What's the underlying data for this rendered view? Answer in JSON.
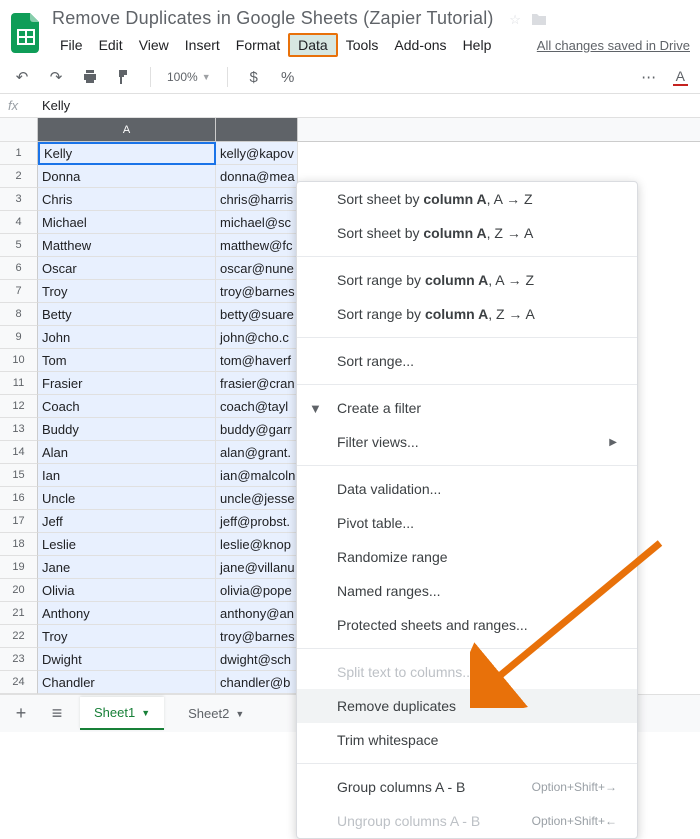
{
  "doc": {
    "title": "Remove Duplicates in Google Sheets (Zapier Tutorial)",
    "saved": "All changes saved in Drive"
  },
  "menubar": [
    "File",
    "Edit",
    "View",
    "Insert",
    "Format",
    "Data",
    "Tools",
    "Add-ons",
    "Help"
  ],
  "menubar_highlight_index": 5,
  "toolbar": {
    "zoom": "100%",
    "currency": "$",
    "percent": "%"
  },
  "formula": {
    "fx": "fx",
    "value": "Kelly"
  },
  "columns": {
    "a": "A",
    "b": ""
  },
  "rows": [
    {
      "n": "1",
      "a": "Kelly",
      "b": "kelly@kapov"
    },
    {
      "n": "2",
      "a": "Donna",
      "b": "donna@mea"
    },
    {
      "n": "3",
      "a": "Chris",
      "b": "chris@harris"
    },
    {
      "n": "4",
      "a": "Michael",
      "b": "michael@sc"
    },
    {
      "n": "5",
      "a": "Matthew",
      "b": "matthew@fc"
    },
    {
      "n": "6",
      "a": "Oscar",
      "b": "oscar@nune"
    },
    {
      "n": "7",
      "a": "Troy",
      "b": "troy@barnes"
    },
    {
      "n": "8",
      "a": "Betty",
      "b": "betty@suare"
    },
    {
      "n": "9",
      "a": "John",
      "b": "john@cho.c"
    },
    {
      "n": "10",
      "a": "Tom",
      "b": "tom@haverf"
    },
    {
      "n": "11",
      "a": "Frasier",
      "b": "frasier@cran"
    },
    {
      "n": "12",
      "a": "Coach",
      "b": "coach@tayl"
    },
    {
      "n": "13",
      "a": "Buddy",
      "b": "buddy@garr"
    },
    {
      "n": "14",
      "a": "Alan",
      "b": "alan@grant."
    },
    {
      "n": "15",
      "a": "Ian",
      "b": "ian@malcoln"
    },
    {
      "n": "16",
      "a": "Uncle",
      "b": "uncle@jesse"
    },
    {
      "n": "17",
      "a": "Jeff",
      "b": "jeff@probst."
    },
    {
      "n": "18",
      "a": "Leslie",
      "b": "leslie@knop"
    },
    {
      "n": "19",
      "a": "Jane",
      "b": "jane@villanu"
    },
    {
      "n": "20",
      "a": "Olivia",
      "b": "olivia@pope"
    },
    {
      "n": "21",
      "a": "Anthony",
      "b": "anthony@an"
    },
    {
      "n": "22",
      "a": "Troy",
      "b": "troy@barnes"
    },
    {
      "n": "23",
      "a": "Dwight",
      "b": "dwight@sch"
    },
    {
      "n": "24",
      "a": "Chandler",
      "b": "chandler@b"
    }
  ],
  "dropdown": {
    "sort_sheet_az_pre": "Sort sheet by ",
    "sort_sheet_az_col": "column A",
    "sort_sheet_az_post": ", A → Z",
    "sort_sheet_za_pre": "Sort sheet by ",
    "sort_sheet_za_col": "column A",
    "sort_sheet_za_post": ", Z → A",
    "sort_range_az_pre": "Sort range by ",
    "sort_range_az_col": "column A",
    "sort_range_az_post": ", A → Z",
    "sort_range_za_pre": "Sort range by ",
    "sort_range_za_col": "column A",
    "sort_range_za_post": ", Z → A",
    "sort_range": "Sort range...",
    "create_filter": "Create a filter",
    "filter_views": "Filter views...",
    "data_validation": "Data validation...",
    "pivot_table": "Pivot table...",
    "randomize": "Randomize range",
    "named_ranges": "Named ranges...",
    "protected": "Protected sheets and ranges...",
    "split_text": "Split text to columns...",
    "remove_dup": "Remove duplicates",
    "trim": "Trim whitespace",
    "group": "Group columns A - B",
    "group_shortcut": "Option+Shift+→",
    "ungroup": "Ungroup columns A - B",
    "ungroup_shortcut": "Option+Shift+←"
  },
  "tabs": {
    "sheet1": "Sheet1",
    "sheet2": "Sheet2"
  }
}
